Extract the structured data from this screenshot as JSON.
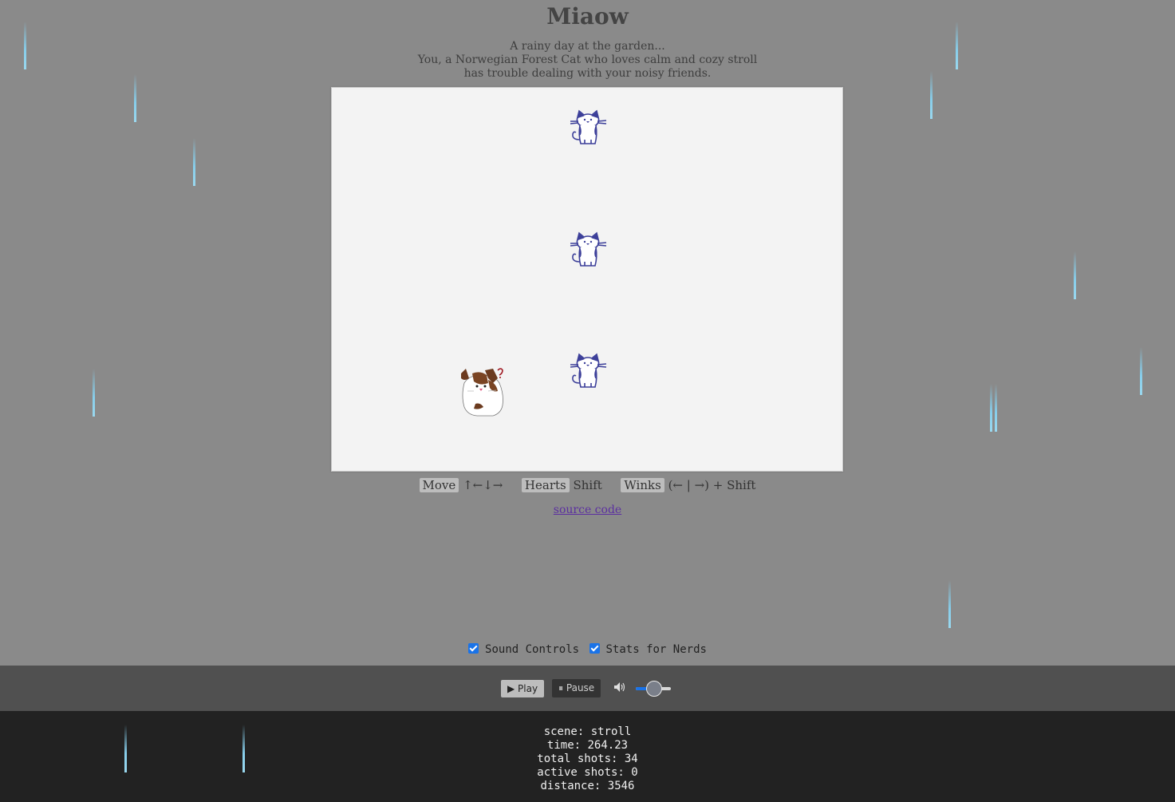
{
  "header": {
    "title": "Miaow",
    "intro_lines": [
      "A rainy day at the garden...",
      "You, a Norwegian Forest Cat who loves calm and cozy stroll",
      "has trouble dealing with your noisy friends."
    ]
  },
  "game": {
    "sprites": [
      {
        "kind": "cat-friend",
        "name": "friend-cat-1"
      },
      {
        "kind": "cat-friend",
        "name": "friend-cat-2"
      },
      {
        "kind": "cat-friend",
        "name": "friend-cat-3"
      },
      {
        "kind": "player-cat",
        "name": "norwegian-forest-cat"
      }
    ],
    "colors": {
      "stage_bg": "#f3f3f3",
      "friend_cat": "#3c3f99",
      "player_patch": "#6b3a1e",
      "rain": "#87ceeb"
    }
  },
  "help": {
    "move_label": "Move",
    "move_keys": "↑←↓→",
    "hearts_label": "Hearts",
    "hearts_keys": "Shift",
    "winks_label": "Winks",
    "winks_keys": "(← | →) + Shift"
  },
  "links": {
    "source_code": "source code"
  },
  "toggles": {
    "sound_controls": "Sound Controls",
    "stats_for_nerds": "Stats for Nerds"
  },
  "player": {
    "play_label": "▶ Play",
    "pause_label": "⏸ Pause",
    "volume_icon": "speaker-icon",
    "volume_level": 0.5
  },
  "stats": {
    "scene": "scene: stroll",
    "time": "time: 264.23",
    "total_shots": "total shots: 34",
    "active_shots": "active shots: 0",
    "distance": "distance: 3546"
  }
}
